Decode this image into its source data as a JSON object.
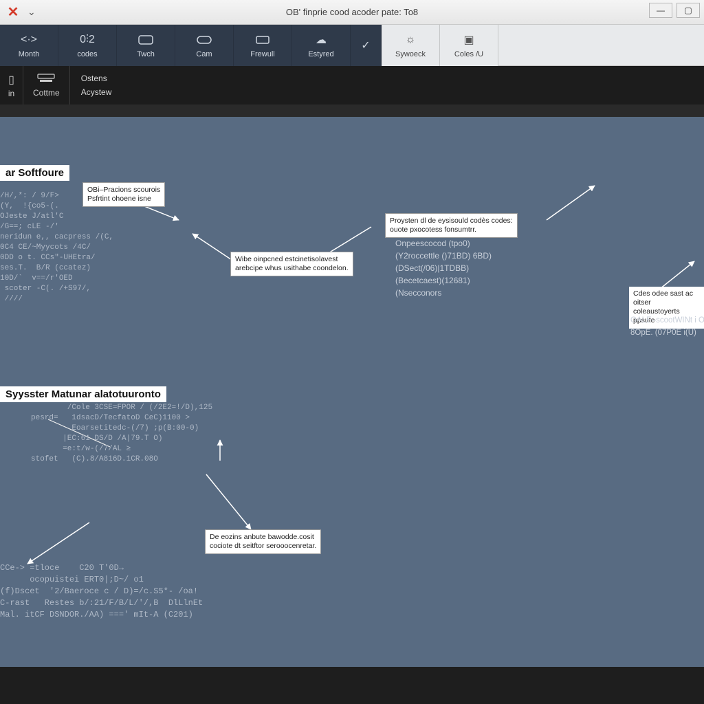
{
  "titlebar": {
    "title": "OB' finprie cood acoder pate: To8"
  },
  "toolbar_primary": {
    "items": [
      {
        "label": "Month",
        "icon": "↔"
      },
      {
        "label": "codes",
        "icon": "0⫶2"
      },
      {
        "label": "Twch",
        "icon": "▭"
      },
      {
        "label": "Cam",
        "icon": "▭"
      },
      {
        "label": "Frewull",
        "icon": "▭"
      },
      {
        "label": "Estyred",
        "icon": "⟳"
      },
      {
        "label": "",
        "icon": "✓"
      }
    ],
    "light_items": [
      {
        "label": "Sywoeck",
        "icon": "⚙"
      },
      {
        "label": "Coles /U",
        "icon": "▣"
      }
    ]
  },
  "toolbar_secondary": {
    "cell1": {
      "icon": "▯",
      "label": "in"
    },
    "cell2": {
      "icon": "▭",
      "label": "Cottme"
    },
    "menu": {
      "item1": "Ostens",
      "item2": "Acystew"
    }
  },
  "canvas": {
    "section1_title": "ar Softfoure",
    "section2_title": "Syysster  Matunar alatotuuronto",
    "callout_a": {
      "line1": "OBi–Pracions scourois",
      "line2": "Psfrtint ohoene isne"
    },
    "callout_b": {
      "line1": "Wibe oinpcned estcinetisolavest",
      "line2": "arebcipe whus usithabe coondelon."
    },
    "callout_c": {
      "line1": "Proysten dl de eysisould codès codes:",
      "line2": "ouote pxocotess fonsumtrr."
    },
    "callout_d": {
      "line1": "Cdes odee sast ac oitser",
      "line2": "coleaustoyerts ppsute",
      "line3": "OALE–scootWINt i OE",
      "line4": "8OpE. (07P0E i(U)"
    },
    "callout_e": {
      "line1": "De eozins anbute bawodde.cosit",
      "line2": "cociote dt seitftor serooocenretar."
    },
    "listing": {
      "l1": "Onpeescocod (tpo0)",
      "l2": "(Y2roccettle ()71BD)   6BD)",
      "l3": "(DSect(/06)|1TDBB)",
      "l4": "(Becetcaest)(12681)",
      "l5": "(Nsecconors"
    },
    "code1": [
      "/H/,*: / 9/F>",
      "(Y,  !{co5-(.",
      "OJeste J/atl'C",
      "/G==; cLE -/'",
      "neridun e,, cacpress /(C,",
      "0C4 CE/~Myycots /4C/",
      "0DD o t. CCs\"-UHEtra/",
      "ses.T.  B/R (ccatez)",
      "10D/`  v==/r'OED",
      " scoter -C(. /+S97/,",
      " ////"
    ],
    "code2": [
      "        /Cole 3CSE=FPOR / (/2E2=!/D),125",
      "pesrd=   1dsacD/TecfatoD CeC)1100 >",
      "         Eoarsetitedc-(/7) ;p(B:00-0)",
      "       |EC:61 DS/D /A|79.T O)",
      "       =e:t/w-(/7/AL ≥",
      "stofet   (C).8/A816D.1CR.08O"
    ],
    "code3": [
      "CCe-> =tloce    C20 T'0D→",
      "      ocopuistei ERT0|;D~/ o1",
      "(f)Dscet  '2/Baeroce c / D)=/c.S5*- /oa!",
      "C-rast   Restes b/:21/F/B/L/'/,B  DlLlnEt",
      "Mal. itCF DSNDOR./AA) ===' mIt-A (C201)"
    ]
  }
}
